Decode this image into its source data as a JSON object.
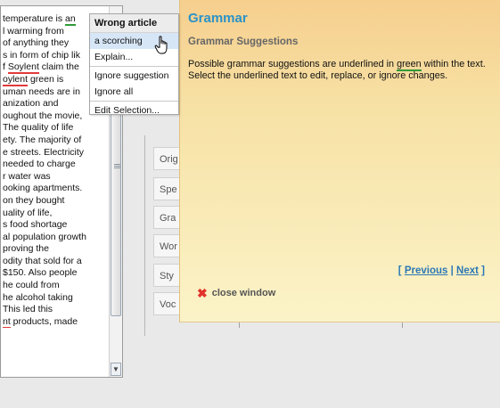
{
  "editor": {
    "lines": [
      {
        "pre": "temperature is ",
        "mark": "an",
        "mark_type": "green",
        "post": ""
      },
      {
        "pre": "l warming from",
        "mark": "",
        "mark_type": "",
        "post": ""
      },
      {
        "pre": "of anything they",
        "mark": "",
        "mark_type": "",
        "post": ""
      },
      {
        "pre": "s in form of chip lik",
        "mark": "",
        "mark_type": "",
        "post": ""
      },
      {
        "pre": "f ",
        "mark": "Soylent",
        "mark_type": "red",
        "post": " claim the"
      },
      {
        "pre": "",
        "mark": "oylent",
        "mark_type": "red",
        "post": " green is"
      },
      {
        "pre": "uman needs are in",
        "mark": "",
        "mark_type": "",
        "post": ""
      },
      {
        "pre": "anization and",
        "mark": "",
        "mark_type": "",
        "post": ""
      },
      {
        "pre": "oughout the movie,",
        "mark": "",
        "mark_type": "",
        "post": ""
      },
      {
        "pre": "The quality of life",
        "mark": "",
        "mark_type": "",
        "post": ""
      },
      {
        "pre": "ety. The majority of",
        "mark": "",
        "mark_type": "",
        "post": ""
      },
      {
        "pre": "e streets. Electricity",
        "mark": "",
        "mark_type": "",
        "post": ""
      },
      {
        "pre": " needed to charge",
        "mark": "",
        "mark_type": "",
        "post": ""
      },
      {
        "pre": "r water was",
        "mark": "",
        "mark_type": "",
        "post": ""
      },
      {
        "pre": "ooking apartments.",
        "mark": "",
        "mark_type": "",
        "post": ""
      },
      {
        "pre": " on they bought",
        "mark": "",
        "mark_type": "",
        "post": ""
      },
      {
        "pre": "uality of life,",
        "mark": "",
        "mark_type": "",
        "post": ""
      },
      {
        "pre": "s food shortage",
        "mark": "",
        "mark_type": "",
        "post": ""
      },
      {
        "pre": "al population growth",
        "mark": "",
        "mark_type": "",
        "post": ""
      },
      {
        "pre": "proving the",
        "mark": "",
        "mark_type": "",
        "post": ""
      },
      {
        "pre": "odity that sold for a",
        "mark": "",
        "mark_type": "",
        "post": ""
      },
      {
        "pre": "$150.  Also people",
        "mark": "",
        "mark_type": "",
        "post": ""
      },
      {
        "pre": " he could from",
        "mark": "",
        "mark_type": "",
        "post": ""
      },
      {
        "pre": "he alcohol taking",
        "mark": "",
        "mark_type": "",
        "post": ""
      },
      {
        "pre": "This led this",
        "mark": "",
        "mark_type": "",
        "post": ""
      },
      {
        "pre": "",
        "mark": "nt",
        "mark_type": "red",
        "post": " products, made"
      }
    ]
  },
  "context_menu": {
    "header": "Wrong article",
    "suggestion": "a scorching",
    "explain": "Explain...",
    "ignore_suggestion": "Ignore suggestion",
    "ignore_all": "Ignore all",
    "edit_selection": "Edit Selection..."
  },
  "tabs": [
    "Orig",
    "Spe",
    "Gra",
    "Wor",
    "Sty",
    "Voc"
  ],
  "help": {
    "title": "Grammar",
    "subtitle": "Grammar Suggestions",
    "desc_pre": "Possible grammar suggestions are underlined in ",
    "desc_green": "green",
    "desc_post": " within the text. Select the underlined text to edit, replace, or ignore changes.",
    "nav_open": "[",
    "previous": "Previous",
    "nav_sep": "|",
    "next": "Next",
    "nav_close": "]",
    "close_label": "close window",
    "close_glyph": "✖"
  },
  "colors": {
    "title_blue": "#2b92c7",
    "grammar_green": "#2f9a38",
    "spelling_red": "#e23a3a",
    "close_red": "#e2332b"
  },
  "icons": {
    "cursor": "hand-pointer-icon",
    "close": "close-x-icon",
    "scroll_down": "chevron-down-icon"
  }
}
